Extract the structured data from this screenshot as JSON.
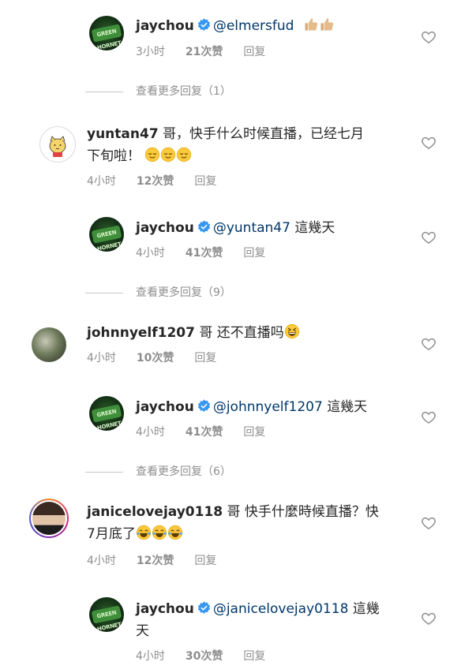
{
  "comments": [
    {
      "user": "jaychou",
      "verified": true,
      "mention": "@elmersfud",
      "text": "",
      "emojis": [
        "thumbs-up",
        "thumbs-up"
      ],
      "time": "3小时",
      "likes": "21次赞",
      "reply": "回复"
    },
    {
      "view_more": "查看更多回复（1）"
    },
    {
      "user": "yuntan47",
      "text_line1": "哥，快手什么时候直播，已经七月",
      "text_line2": "下旬啦！",
      "emojis": [
        "relieved-face",
        "relieved-face",
        "relieved-face"
      ],
      "time": "4小时",
      "likes": "12次赞",
      "reply": "回复"
    },
    {
      "user": "jaychou",
      "verified": true,
      "mention": "@yuntan47",
      "text": "這幾天",
      "time": "4小时",
      "likes": "41次赞",
      "reply": "回复"
    },
    {
      "view_more": "查看更多回复（9）"
    },
    {
      "user": "johnnyelf1207",
      "text": "哥 还不直播吗",
      "emojis": [
        "grinning-squinting-face"
      ],
      "time": "4小时",
      "likes": "10次赞",
      "reply": "回复"
    },
    {
      "user": "jaychou",
      "verified": true,
      "mention": "@johnnyelf1207",
      "text": "這幾天",
      "time": "4小时",
      "likes": "41次赞",
      "reply": "回复"
    },
    {
      "view_more": "查看更多回复（6）"
    },
    {
      "user": "janicelovejay0118",
      "text_line1": "哥 快手什麼時候直播？快",
      "text_line2": "7月底了",
      "emojis": [
        "tears-of-joy",
        "tears-of-joy",
        "tears-of-joy"
      ],
      "time": "4小时",
      "likes": "12次赞",
      "reply": "回复"
    },
    {
      "user": "jaychou",
      "verified": true,
      "mention": "@janicelovejay0118",
      "text_line1": "這幾",
      "text_line2": "天",
      "time": "4小时",
      "likes": "30次赞",
      "reply": "回复"
    }
  ],
  "avatar_logo_text": "GREEN HORNET",
  "colors": {
    "username": "#262626",
    "mention": "#00376b",
    "meta": "#8e8e8e",
    "verified": "#3897f0"
  }
}
